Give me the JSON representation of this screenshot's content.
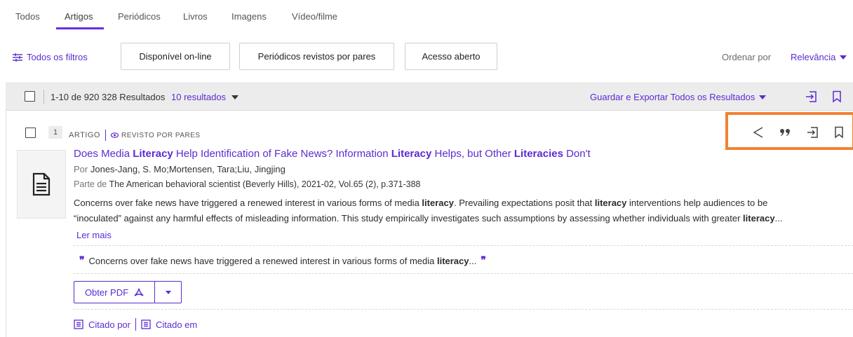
{
  "tabs": [
    {
      "label": "Todos"
    },
    {
      "label": "Artigos"
    },
    {
      "label": "Periódicos"
    },
    {
      "label": "Livros"
    },
    {
      "label": "Imagens"
    },
    {
      "label": "Vídeo/filme"
    }
  ],
  "filters": {
    "all_label": "Todos os filtros",
    "chips": [
      "Disponível on-line",
      "Periódicos revistos por pares",
      "Acesso aberto"
    ],
    "sort_label": "Ordenar por",
    "sort_value": "Relevância"
  },
  "results_bar": {
    "count_text": "1-10 de 920 328 Resultados",
    "per_page": "10 resultados",
    "export_label": "Guardar e Exportar Todos os Resultados"
  },
  "result": {
    "number": "1",
    "type": "ARTIGO",
    "peer_reviewed": "REVISTO POR PARES",
    "title_parts": [
      {
        "text": "Does Media ",
        "bold": false
      },
      {
        "text": "Literacy",
        "bold": true
      },
      {
        "text": " Help Identification of Fake News? Information ",
        "bold": false
      },
      {
        "text": "Literacy",
        "bold": true
      },
      {
        "text": " Helps, but Other ",
        "bold": false
      },
      {
        "text": "Literacies",
        "bold": true
      },
      {
        "text": " Don't",
        "bold": false
      }
    ],
    "authors_prefix": "Por",
    "authors": "Jones-Jang, S. Mo;Mortensen, Tara;Liu, Jingjing",
    "part_of_prefix": "Parte de",
    "part_of": "The American behavioral scientist (Beverly Hills), 2021-02, Vol.65 (2), p.371-388",
    "abstract_line1": [
      {
        "text": "Concerns over fake news have triggered a renewed interest in various forms of media ",
        "bold": false
      },
      {
        "text": "literacy",
        "bold": true
      },
      {
        "text": ". Prevailing expectations posit that ",
        "bold": false
      },
      {
        "text": "literacy",
        "bold": true
      },
      {
        "text": " interventions help audiences to be",
        "bold": false
      }
    ],
    "abstract_line2": [
      {
        "text": "“inoculated” against any harmful effects of misleading information. This study empirically investigates such assumptions by assessing whether individuals with greater ",
        "bold": false
      },
      {
        "text": "literacy",
        "bold": true
      },
      {
        "text": "...",
        "bold": false
      }
    ],
    "read_more": "Ler mais",
    "snippet": [
      {
        "text": "Concerns over fake news have triggered a renewed interest in various forms of media ",
        "bold": false
      },
      {
        "text": "literacy",
        "bold": true
      },
      {
        "text": "...",
        "bold": false
      }
    ],
    "pdf_label": "Obter PDF",
    "cited_by": "Citado por",
    "cited_in": "Citado em"
  },
  "colors": {
    "accent": "#5b2bd1",
    "highlight": "#f08232"
  },
  "icons": [
    "filter-sliders-icon",
    "chevron-down-icon",
    "export-icon",
    "bookmark-icon",
    "share-icon",
    "cite-icon",
    "pdf-icon",
    "document-icon",
    "citation-list-icon",
    "eye-icon"
  ]
}
